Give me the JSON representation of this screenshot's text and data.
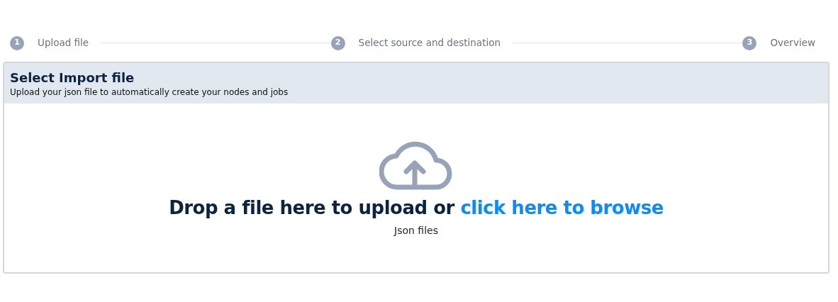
{
  "steps": [
    {
      "number": "1",
      "label": "Upload file"
    },
    {
      "number": "2",
      "label": "Select source and destination"
    },
    {
      "number": "3",
      "label": "Overview"
    }
  ],
  "card": {
    "title": "Select Import file",
    "subtitle": "Upload your json file to automatically create your nodes and jobs"
  },
  "dropzone": {
    "text": "Drop a file here to upload or",
    "link": "click here to browse",
    "hint": "Json files"
  }
}
